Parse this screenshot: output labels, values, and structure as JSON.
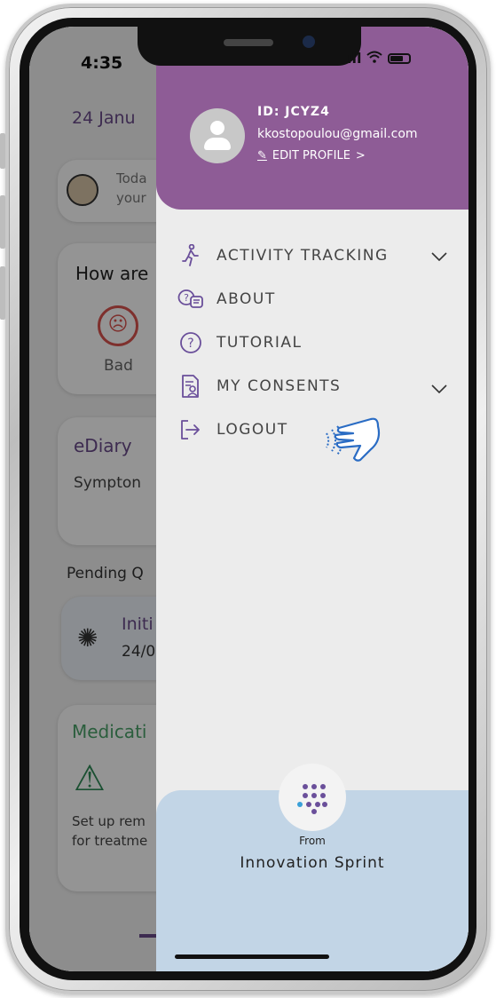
{
  "status_bar": {
    "time": "4:35",
    "battery_level": 0.7
  },
  "background_app": {
    "date": "24 Janu",
    "tip_text_line1": "Toda",
    "tip_text_line2": "your",
    "mood_question": "How are",
    "mood_label": "Bad",
    "diary_title": "eDiary",
    "diary_subtitle": "Sympton",
    "pending_label": "Pending Q",
    "questionnaire_title": "Initi",
    "questionnaire_date": "24/0",
    "medication_title": "Medicati",
    "medication_text_line1": "Set up rem",
    "medication_text_line2": "for treatme"
  },
  "drawer": {
    "user": {
      "id_label": "ID: JCYZ4",
      "email": "kkostopoulou@gmail.com",
      "edit_profile_label": "EDIT PROFILE",
      "edit_profile_chevron": ">"
    },
    "menu": [
      {
        "label": "ACTIVITY TRACKING",
        "icon": "walking-person-icon",
        "expandable": true
      },
      {
        "label": "ABOUT",
        "icon": "chat-bubbles-icon",
        "expandable": false
      },
      {
        "label": "TUTORIAL",
        "icon": "question-circle-icon",
        "expandable": false
      },
      {
        "label": "MY CONSENTS",
        "icon": "consent-document-icon",
        "expandable": true
      },
      {
        "label": "LOGOUT",
        "icon": "logout-arrow-icon",
        "expandable": false
      }
    ],
    "footer": {
      "from_label": "From",
      "company_name": "Innovation Sprint"
    }
  },
  "colors": {
    "header_purple": "#8e5c96",
    "icon_purple": "#6a4f9a",
    "footer_blue": "#c2d5e6",
    "pointer_blue": "#2a6cc4"
  }
}
